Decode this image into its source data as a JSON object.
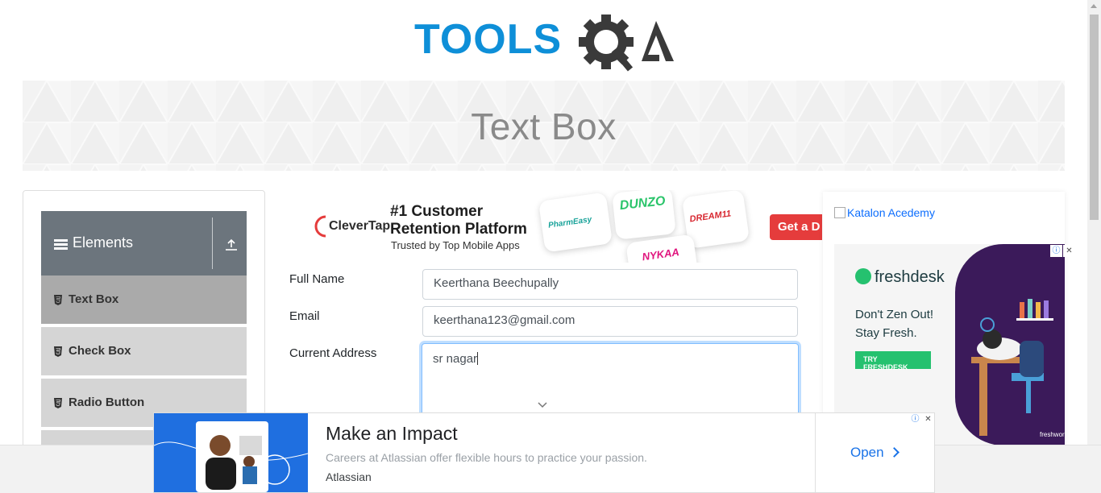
{
  "logo": {
    "text_a": "TOOLS",
    "text_b": "QA",
    "brand_blue": "#0e8fd8",
    "brand_dark": "#3a3a3a"
  },
  "banner": {
    "title": "Text Box"
  },
  "sidebar": {
    "group": {
      "label": "Elements",
      "icon": "hamburger-icon",
      "collapse_icon": "upload-arrow-icon"
    },
    "items": [
      {
        "label": "Text Box",
        "active": true
      },
      {
        "label": "Check Box",
        "active": false
      },
      {
        "label": "Radio Button",
        "active": false
      }
    ]
  },
  "top_ad": {
    "brand": "CleverTap",
    "headline": "#1 Customer Retention Platform",
    "subline": "Trusted by Top Mobile Apps",
    "cards": [
      "PharmEasy",
      "DUNZO",
      "DREAM11",
      "NYKAA"
    ],
    "cta": "Get a D"
  },
  "form": {
    "full_name": {
      "label": "Full Name",
      "value": "Keerthana Beechupally"
    },
    "email": {
      "label": "Email",
      "value": "keerthana123@gmail.com"
    },
    "current_address": {
      "label": "Current Address",
      "value": "sr nagar"
    }
  },
  "right_ad": {
    "katalon_alt": "Katalon Acedemy",
    "freshdesk": {
      "brand": "freshdesk",
      "headline_1": "Don't Zen Out!",
      "headline_2": "Stay Fresh.",
      "button": "TRY FRESHDESK",
      "footer": "freshworks"
    }
  },
  "bottom_ad": {
    "title": "Make an Impact",
    "description": "Careers at Atlassian offer flexible hours to practice your passion.",
    "advertiser": "Atlassian",
    "cta": "Open"
  },
  "ad_controls": {
    "info": "ⓘ",
    "close": "✕"
  }
}
